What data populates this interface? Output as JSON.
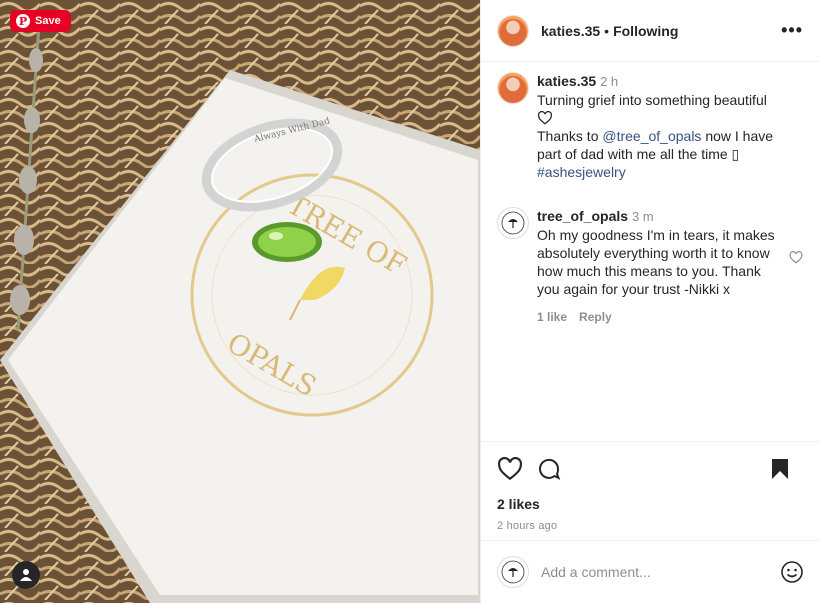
{
  "photo": {
    "save_label": "Save",
    "pinterest_icon": "pinterest-p",
    "box_text_top": "TREE OF",
    "box_text_bottom": "OPALS",
    "ring_inscription": "Always With Dad"
  },
  "header": {
    "username": "katies.35",
    "separator": "•",
    "follow_label": "Following",
    "more_icon": "more-dots-icon"
  },
  "caption": {
    "username": "katies.35",
    "time": "2 h",
    "text_line1": "Turning grief into something beautiful",
    "text_mid": "Thanks to ",
    "mention": "@tree_of_opals",
    "text_end": " now I have part of dad with me all the time ",
    "glyph": "▯",
    "hashtag": "#ashesjewelry"
  },
  "reply": {
    "username": "tree_of_opals",
    "time": "3 m",
    "text": "Oh my goodness I'm in tears, it makes absolutely everything worth it to know how much this means to you. Thank you again for your trust -Nikki x",
    "likes_label": "1 like",
    "reply_label": "Reply"
  },
  "actions": {
    "likes": "2 likes",
    "when": "2 hours ago"
  },
  "composer": {
    "placeholder": "Add a comment..."
  },
  "colors": {
    "accent_link": "#385185",
    "pinterest_red": "#e60023",
    "text": "#262626",
    "muted": "#8e8e8e"
  }
}
